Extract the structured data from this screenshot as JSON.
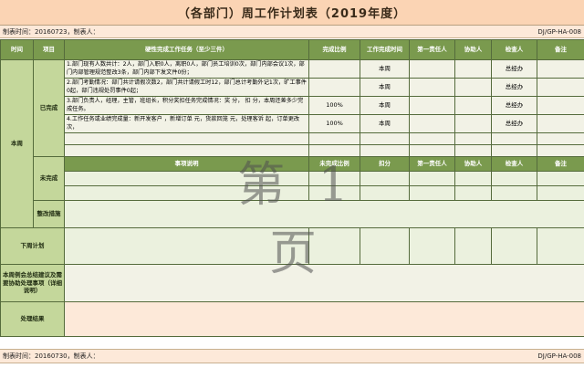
{
  "header": {
    "title": "（各部门）周工作计划表（2019年度）",
    "made_time": "制表时间：20160723，制表人：",
    "doc_code": "DJ/GP-HA-008"
  },
  "footer": {
    "made_time": "制表时间：20160730，制表人：",
    "doc_code": "DJ/GP-HA-008"
  },
  "columns": {
    "time": "时间",
    "item": "项目",
    "task": "硬性完成工作任务（至少三件）",
    "ratio": "完成比例",
    "deadline": "工作完成时间",
    "owner": "第一责任人",
    "assist": "协助人",
    "checker": "检查人",
    "remark": "备注"
  },
  "section_labels": {
    "this_week": "本周",
    "done": "已完成",
    "undone": "未完成",
    "fix": "整改措施",
    "next_week": "下周计划",
    "summary": "本周例会总结建议及需要协助处理事项（详细说明）",
    "result": "处理结果"
  },
  "done_rows": [
    {
      "task": "1.部门现有人数共计：2人，部门入职0人，离职0人，部门员工培训0次，部门内部会议1次，部门内部管理规范整改3条，部门内部下发文件0份；",
      "ratio": "",
      "deadline": "本周",
      "checker": "总经办"
    },
    {
      "task": "2.部门考勤情况：部门共计请假次数2，部门共计请假工时12，部门总计考勤外记1次，旷工事件0起，部门违规处罚事件0起；",
      "ratio": "",
      "deadline": "本周",
      "checker": "总经办"
    },
    {
      "task": "3.部门负责人，经理，主管，班组长，积分奖扣任务完成情况：奖  分， 扣  分，本周还差多少完成任务。",
      "ratio": "100%",
      "deadline": "本周",
      "checker": "总经办"
    },
    {
      "task": "4.工作任务或业绩完成量：新开发客户    ，新增订单   元，货款回笼    元，处理客诉    起，订单更改    次，",
      "ratio": "100%",
      "deadline": "本周",
      "checker": "总经办"
    }
  ],
  "undone_header": {
    "item": "事项说明",
    "ratio": "未完成比例",
    "deduct": "扣分",
    "owner": "第一责任人",
    "assist": "协助人",
    "checker": "检查人",
    "remark": "备注"
  },
  "watermark": "第 1 页"
}
